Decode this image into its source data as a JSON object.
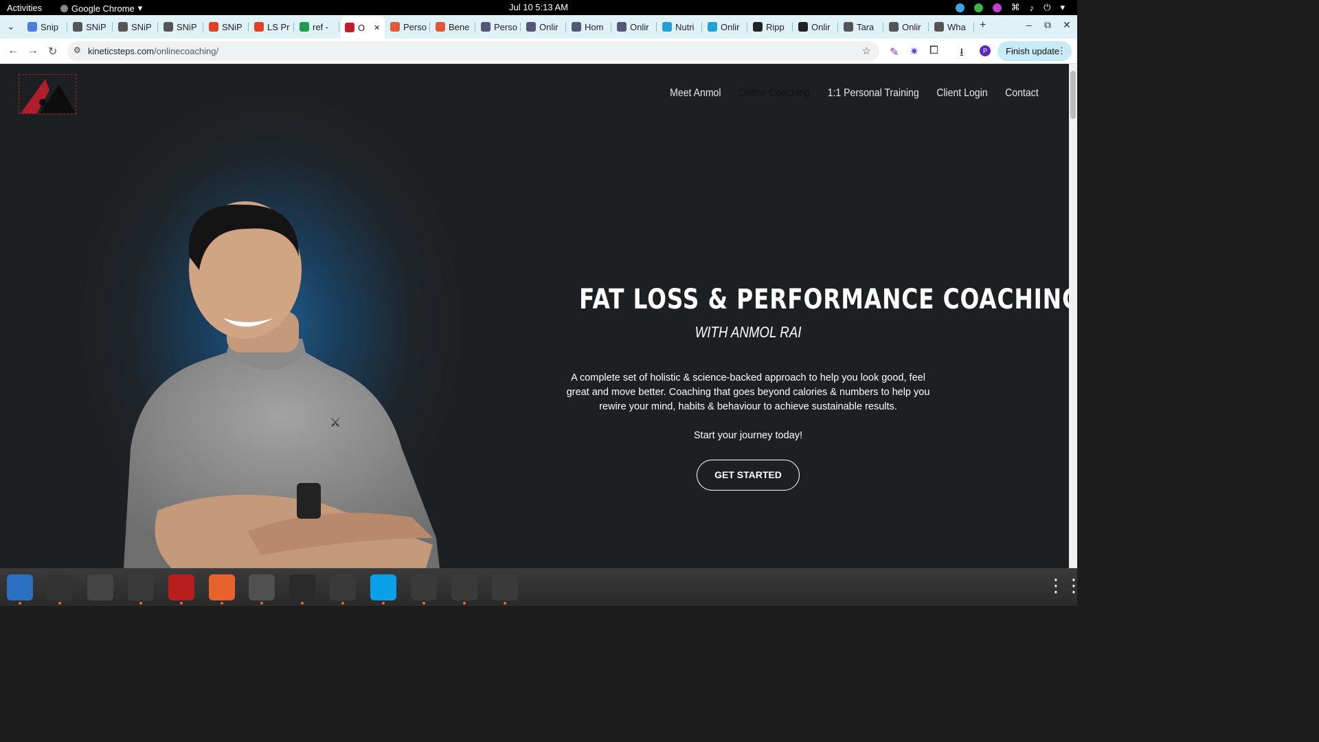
{
  "topbar": {
    "activities": "Activities",
    "app": "Google Chrome",
    "clock": "Jul 10  5:13 AM"
  },
  "tabs": [
    {
      "label": "Snip",
      "color": "#4a7ee0"
    },
    {
      "label": "SNiP",
      "color": "#555"
    },
    {
      "label": "SNiP",
      "color": "#555"
    },
    {
      "label": "SNiP",
      "color": "#555"
    },
    {
      "label": "SNiP",
      "color": "#e0402a"
    },
    {
      "label": "LS Pr",
      "color": "#e0402a"
    },
    {
      "label": "ref -",
      "color": "#1e9e4a"
    },
    {
      "label": "O",
      "color": "#c0202a"
    },
    {
      "label": "Perso",
      "color": "#e05a3a"
    },
    {
      "label": "Bene",
      "color": "#e05a3a"
    },
    {
      "label": "Perso",
      "color": "#557"
    },
    {
      "label": "Onlir",
      "color": "#557"
    },
    {
      "label": "Hom",
      "color": "#557"
    },
    {
      "label": "Onlir",
      "color": "#557"
    },
    {
      "label": "Nutri",
      "color": "#22a0d8"
    },
    {
      "label": "Onlir",
      "color": "#22a0d8"
    },
    {
      "label": "Ripp",
      "color": "#222"
    },
    {
      "label": "Onlir",
      "color": "#222"
    },
    {
      "label": "Tara",
      "color": "#555"
    },
    {
      "label": "Onlir",
      "color": "#555"
    },
    {
      "label": "Wha",
      "color": "#555"
    }
  ],
  "address": {
    "domain": "kineticsteps.com",
    "path": "/onlinecoaching/",
    "finish_update": "Finish update"
  },
  "menu": [
    "Meet Anmol",
    "Online Coaching",
    "1:1 Personal Training",
    "Client Login",
    "Contact"
  ],
  "hero": {
    "title": "FAT LOSS & PERFORMANCE COACHING",
    "subtitle": "WITH ANMOL RAI",
    "description": "A complete set of holistic & science-backed approach to help you look good, feel great and move better. Coaching that goes beyond calories & numbers to help you rewire your mind, habits & behaviour to achieve sustainable results.",
    "cta_text": "Start your journey today!",
    "button": "GET STARTED"
  },
  "dock": [
    {
      "name": "thunderbird-icon",
      "color": "#2a6fc0"
    },
    {
      "name": "terminal-icon",
      "color": "#333"
    },
    {
      "name": "calculator-icon",
      "color": "#444"
    },
    {
      "name": "system-monitor-icon",
      "color": "#3a3a3a"
    },
    {
      "name": "filezilla-icon",
      "color": "#b81d1d"
    },
    {
      "name": "firefox-icon",
      "color": "#e8632b"
    },
    {
      "name": "chrome-icon",
      "color": "#3a3a3a"
    },
    {
      "name": "vscode-icon",
      "color": "#2a2a2a"
    },
    {
      "name": "files-icon",
      "color": "#3a3a3a"
    },
    {
      "name": "skype-icon",
      "color": "#0aa0e8"
    },
    {
      "name": "text-editor-icon",
      "color": "#3a3a3a"
    },
    {
      "name": "writer-icon",
      "color": "#3a3a3a"
    },
    {
      "name": "disk-icon",
      "color": "#3a3a3a"
    }
  ]
}
